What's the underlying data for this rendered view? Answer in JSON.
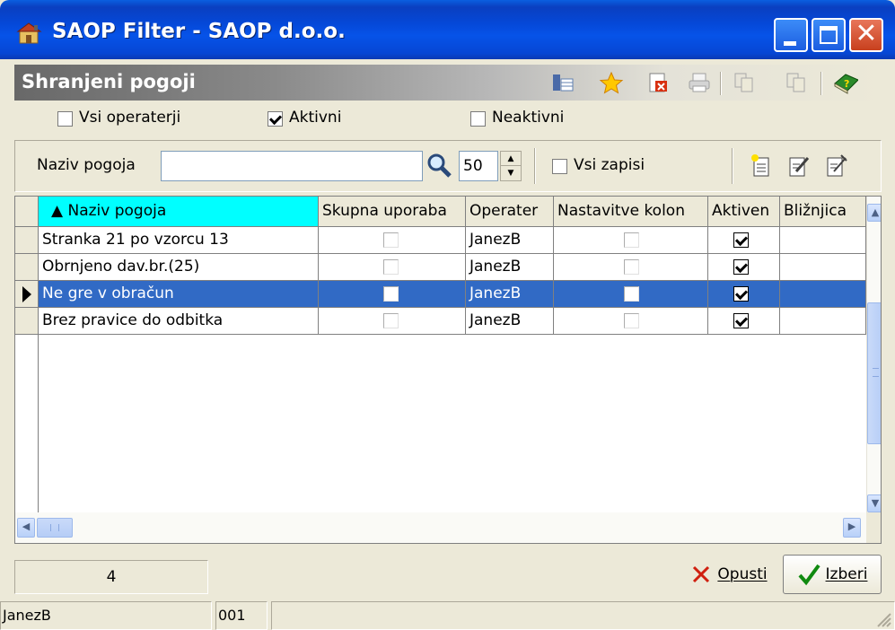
{
  "window": {
    "title": "SAOP Filter  - SAOP d.o.o."
  },
  "header": {
    "title": "Shranjeni pogoji"
  },
  "filters": {
    "all_operators": {
      "label": "Vsi operaterji",
      "checked": false
    },
    "active": {
      "label": "Aktivni",
      "checked": true
    },
    "inactive": {
      "label": "Neaktivni",
      "checked": false
    }
  },
  "search": {
    "label": "Naziv pogoja",
    "value": "",
    "limit": "50",
    "all_records_label": "Vsi zapisi",
    "all_records_checked": false
  },
  "grid": {
    "columns": [
      "▲ Naziv pogoja",
      "Skupna uporaba",
      "Operater",
      "Nastavitve kolon",
      "Aktiven",
      "Bližnjica"
    ],
    "rows": [
      {
        "name": "Stranka 21 po vzorcu 13",
        "shared": false,
        "operator": "JanezB",
        "column_settings": false,
        "active": true,
        "shortcut": ""
      },
      {
        "name": "Obrnjeno dav.br.(25)",
        "shared": false,
        "operator": "JanezB",
        "column_settings": false,
        "active": true,
        "shortcut": ""
      },
      {
        "name": "Ne gre v obračun",
        "shared": false,
        "operator": "JanezB",
        "column_settings": false,
        "active": true,
        "shortcut": "",
        "selected": true
      },
      {
        "name": "Brez pravice do odbitka",
        "shared": false,
        "operator": "JanezB",
        "column_settings": false,
        "active": true,
        "shortcut": ""
      }
    ]
  },
  "footer": {
    "count": "4",
    "cancel_label": "Opusti",
    "select_label": "Izberi"
  },
  "statusbar": {
    "user": "JanezB",
    "code": "001"
  },
  "colors": {
    "selection": "#316ac5",
    "sorted_header": "#00ffff",
    "titlebar": "#0548d8"
  }
}
